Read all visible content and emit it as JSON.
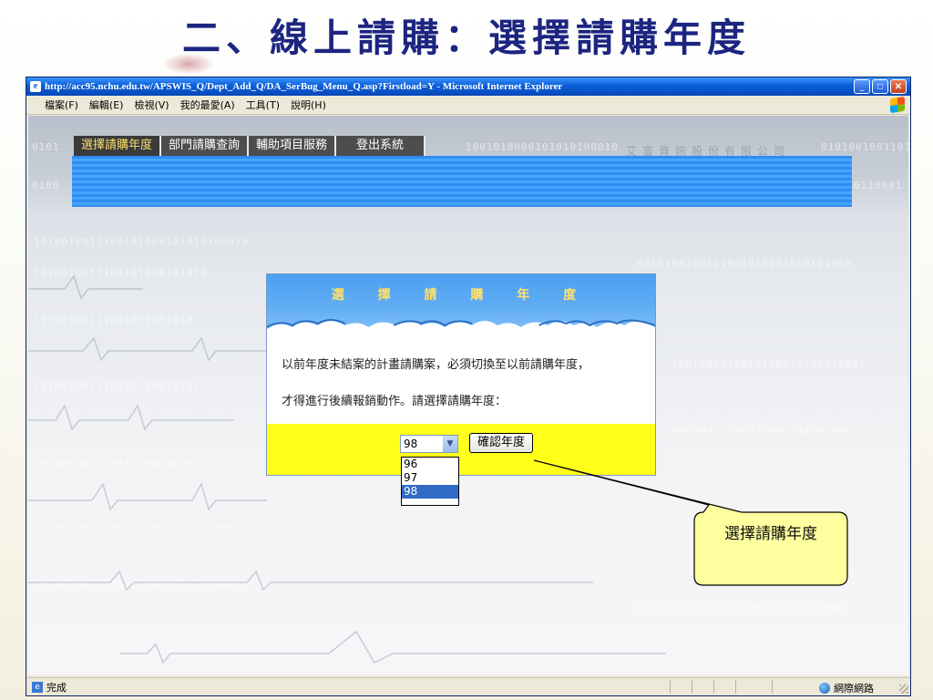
{
  "slide": {
    "title": "二、線上請購：選擇請購年度"
  },
  "window": {
    "title": "http://acc95.nchu.edu.tw/APSWIS_Q/Dept_Add_Q/DA_SerBug_Menu_Q.asp?Firstload=Y - Microsoft Internet Explorer",
    "menu": [
      "檔案(F)",
      "編輯(E)",
      "檢視(V)",
      "我的最愛(A)",
      "工具(T)",
      "說明(H)"
    ]
  },
  "app": {
    "company": "艾富資訊股份有限公司",
    "tabs": [
      {
        "label": "選擇請購年度",
        "active": true
      },
      {
        "label": "部門請購查詢",
        "active": false
      },
      {
        "label": "輔助項目服務",
        "active": false
      },
      {
        "label": "登出系統",
        "active": false
      }
    ]
  },
  "dialog": {
    "title": "選 擇 請 購 年 度",
    "message_line1": "以前年度未結案的計畫請購案，必須切換至以前請購年度，",
    "message_line2": "才得進行後續報銷動作。請選擇請購年度：",
    "year_select": {
      "value": "98",
      "options": [
        "96",
        "97",
        "98"
      ],
      "highlighted": "98"
    },
    "confirm_label": "確認年度"
  },
  "callout": {
    "text": "選擇請購年度"
  },
  "status": {
    "text": "完成",
    "zone": "網際網路"
  },
  "colors": {
    "title_blue": "#1c2580",
    "tab_active_text": "#ffdf6b",
    "header_blue": "#2f8df2",
    "footer_yellow": "#ffff1a",
    "callout_yellow": "#ffffa0",
    "selection_blue": "#316ac5"
  },
  "icons": {
    "ie_page": "ie-page-icon",
    "windows_flag": "windows-flag-icon",
    "globe": "globe-icon",
    "dropdown": "chevron-down-icon"
  }
}
